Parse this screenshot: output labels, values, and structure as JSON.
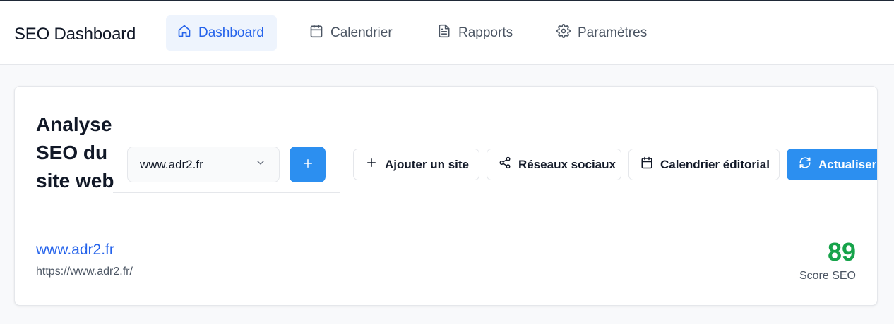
{
  "header": {
    "brand": "SEO Dashboard",
    "nav": [
      {
        "label": "Dashboard",
        "icon": "home-icon",
        "active": true
      },
      {
        "label": "Calendrier",
        "icon": "calendar-icon",
        "active": false
      },
      {
        "label": "Rapports",
        "icon": "document-icon",
        "active": false
      },
      {
        "label": "Paramètres",
        "icon": "gear-icon",
        "active": false
      }
    ]
  },
  "main": {
    "title": "Analyse SEO du site web",
    "site_select": {
      "value": "www.adr2.fr",
      "icon": "chevron-down-icon"
    },
    "add_site_icon_button": {
      "icon": "plus-icon"
    },
    "actions": {
      "add_site": {
        "label": "Ajouter un site",
        "icon": "plus-icon"
      },
      "social": {
        "label": "Réseaux sociaux",
        "icon": "share-icon"
      },
      "calendar": {
        "label": "Calendrier éditorial",
        "icon": "calendar-icon"
      },
      "refresh": {
        "label": "Actualiser l'an",
        "icon": "refresh-icon"
      }
    },
    "site": {
      "name": "www.adr2.fr",
      "url": "https://www.adr2.fr/"
    },
    "score": {
      "value": "89",
      "label": "Score SEO"
    }
  },
  "colors": {
    "accent": "#2c8ff0",
    "active_nav_bg": "#eef4fd",
    "link": "#2563eb",
    "score_good": "#16a34a"
  }
}
